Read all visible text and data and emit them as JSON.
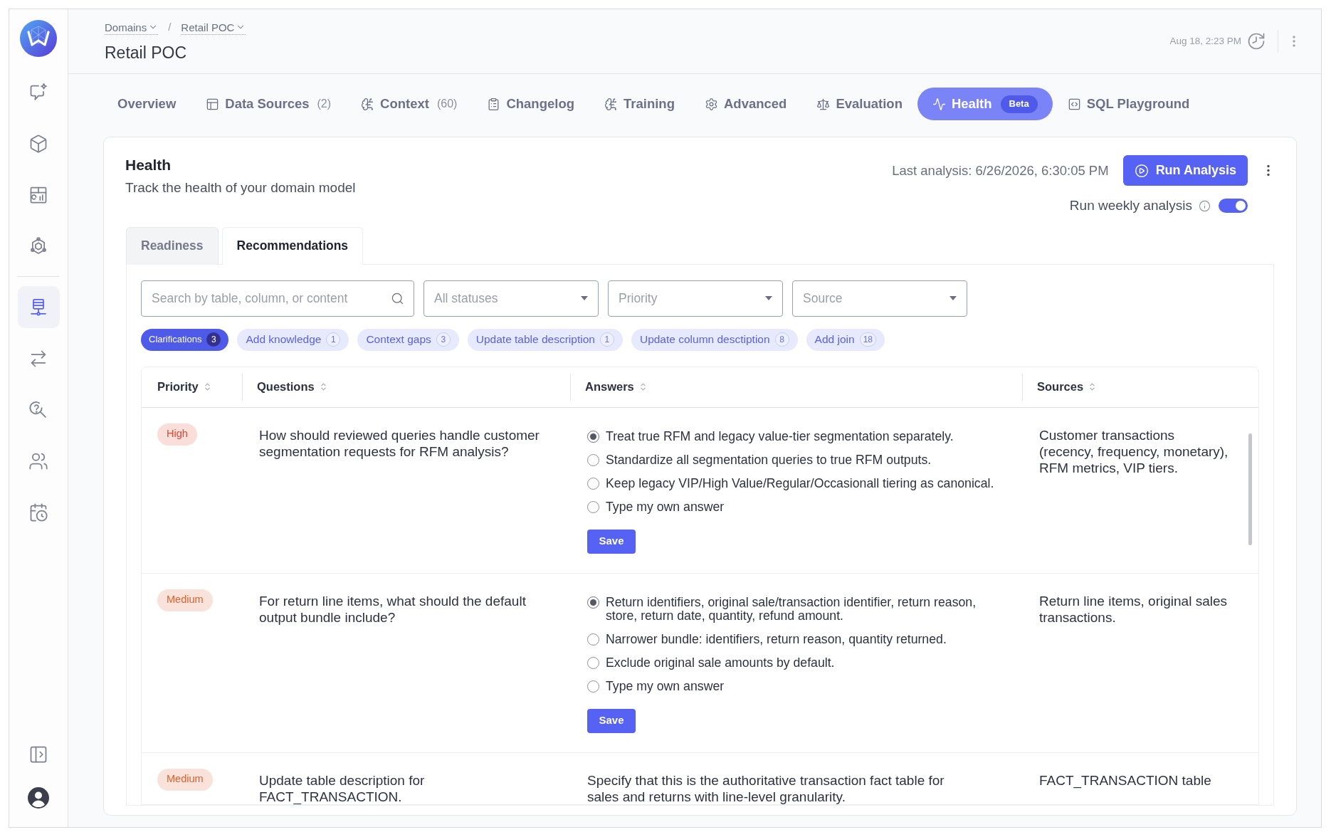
{
  "sidebar": {
    "items": [
      {
        "selected": false
      },
      {
        "selected": false
      },
      {
        "selected": false
      },
      {
        "selected": false
      },
      {
        "selected": true
      },
      {
        "selected": false
      },
      {
        "selected": false
      },
      {
        "selected": false
      },
      {
        "selected": false
      }
    ]
  },
  "header": {
    "breadcrumbs": [
      {
        "label": "Domains"
      },
      {
        "label": "Retail POC"
      }
    ],
    "separator": "/",
    "title": "Retail POC",
    "timestamp": "Aug 18, 2:23 PM"
  },
  "tabs": [
    {
      "label": "Overview",
      "selected": false
    },
    {
      "label": "Data Sources",
      "count": "(2)",
      "selected": false
    },
    {
      "label": "Context",
      "count": "(60)",
      "selected": false
    },
    {
      "label": "Changelog",
      "selected": false
    },
    {
      "label": "Training",
      "selected": false
    },
    {
      "label": "Advanced",
      "selected": false
    },
    {
      "label": "Evaluation",
      "selected": false
    },
    {
      "label": "Health",
      "badge": "Beta",
      "selected": true
    },
    {
      "label": "SQL Playground",
      "selected": false
    }
  ],
  "health": {
    "title": "Health",
    "subtitle": "Track the health of your domain model",
    "last_analysis": "Last analysis: 6/26/2026, 6:30:05 PM",
    "run_button": "Run Analysis",
    "weekly_analysis": {
      "label": "Run weekly analysis",
      "on": true
    }
  },
  "subtabs": [
    {
      "label": "Readiness",
      "selected": false
    },
    {
      "label": "Recommendations",
      "selected": true
    }
  ],
  "filters": {
    "search": {
      "placeholder": "Search by table, column, or content"
    },
    "dropdowns": [
      {
        "placeholder": "All statuses"
      },
      {
        "placeholder": "Priority"
      },
      {
        "placeholder": "Source"
      }
    ]
  },
  "chips": [
    {
      "label": "Clarifications",
      "count": "3",
      "selected": true
    },
    {
      "label": "Add knowledge",
      "count": "1",
      "selected": false
    },
    {
      "label": "Context gaps",
      "count": "3",
      "selected": false
    },
    {
      "label": "Update table description",
      "count": "1",
      "selected": false
    },
    {
      "label": "Update column desctiption",
      "count": "8",
      "selected": false
    },
    {
      "label": "Add join",
      "count": "18",
      "selected": false
    }
  ],
  "table": {
    "columns": [
      "Priority",
      "Questions",
      "Answers",
      "Sources"
    ],
    "rows": [
      {
        "priority": {
          "label": "High",
          "color": "#dc4a33"
        },
        "question": "How should reviewed queries handle customer segmentation requests for RFM analysis?",
        "answer": {
          "kind": "choices",
          "options": [
            {
              "label": "Treat true RFM and legacy value-tier segmentation separately.",
              "selected": true
            },
            {
              "label": "Standardize all segmentation queries to true RFM outputs.",
              "selected": false
            },
            {
              "label": "Keep legacy VIP/High Value/Regular/Occasionall tiering as canonical.",
              "selected": false
            },
            {
              "label": "Type my own answer",
              "selected": false
            }
          ],
          "save_button": "Save"
        },
        "sources": "Customer transactions (recency, frequency, monetary), RFM metrics, VIP tiers."
      },
      {
        "priority": {
          "label": "Medium",
          "color": "#e0602c"
        },
        "question": "For return line items, what should the default output bundle include?",
        "answer": {
          "kind": "choices",
          "options": [
            {
              "label": "Return identifiers, original sale/transaction identifier, return reason, store, return date, quantity, refund amount.",
              "selected": true
            },
            {
              "label": "Narrower bundle: identifiers, return reason, quantity returned.",
              "selected": false
            },
            {
              "label": "Exclude original sale amounts by default.",
              "selected": false
            },
            {
              "label": "Type my own answer",
              "selected": false
            }
          ],
          "save_button": "Save"
        },
        "sources": "Return line items, original sales transactions."
      },
      {
        "priority": {
          "label": "Medium",
          "color": "#e0602c"
        },
        "question": "Update table description for FACT_TRANSACTION.",
        "answer": {
          "kind": "text",
          "text": "Specify that this is the authoritative transaction fact table for sales and returns with line-level granularity."
        },
        "sources": "FACT_TRANSACTION table"
      }
    ]
  }
}
